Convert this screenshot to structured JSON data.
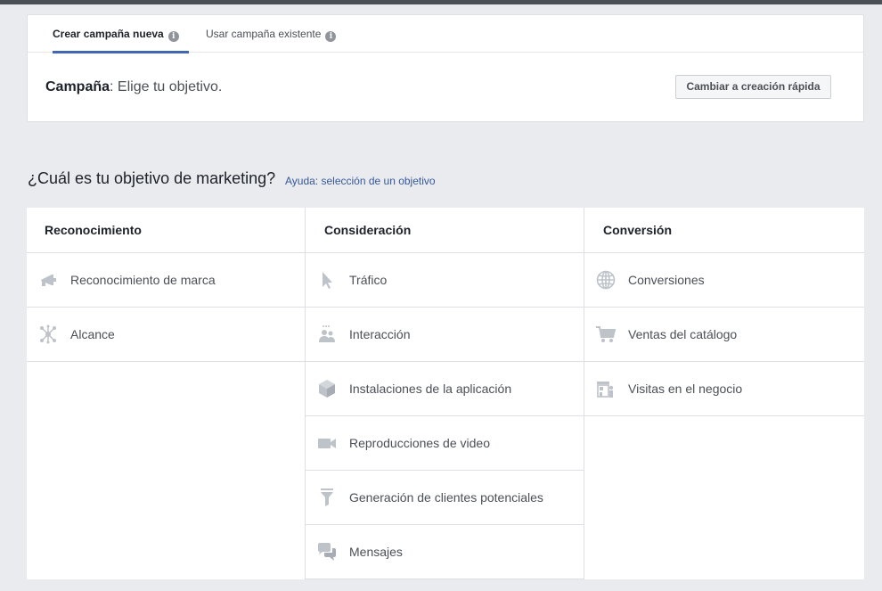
{
  "tabs": [
    {
      "label": "Crear campaña nueva",
      "icon": "info-icon"
    },
    {
      "label": "Usar campaña existente",
      "icon": "info-icon"
    }
  ],
  "campaign": {
    "label": "Campaña",
    "text": ": Elige tu objetivo."
  },
  "quick_button": "Cambiar a creación rápida",
  "question": "¿Cuál es tu objetivo de marketing?",
  "help_link": "Ayuda: selección de un objetivo",
  "columns": [
    {
      "title": "Reconocimiento",
      "items": [
        {
          "label": "Reconocimiento de marca",
          "icon": "megaphone-icon"
        },
        {
          "label": "Alcance",
          "icon": "reach-icon"
        }
      ]
    },
    {
      "title": "Consideración",
      "items": [
        {
          "label": "Tráfico",
          "icon": "cursor-icon"
        },
        {
          "label": "Interacción",
          "icon": "people-icon"
        },
        {
          "label": "Instalaciones de la aplicación",
          "icon": "box-icon"
        },
        {
          "label": "Reproducciones de video",
          "icon": "video-camera-icon"
        },
        {
          "label": "Generación de clientes potenciales",
          "icon": "funnel-icon"
        },
        {
          "label": "Mensajes",
          "icon": "chat-bubbles-icon"
        }
      ]
    },
    {
      "title": "Conversión",
      "items": [
        {
          "label": "Conversiones",
          "icon": "globe-icon"
        },
        {
          "label": "Ventas del catálogo",
          "icon": "cart-icon"
        },
        {
          "label": "Visitas en el negocio",
          "icon": "store-icon"
        }
      ]
    }
  ],
  "colors": {
    "accent": "#4267b2",
    "link": "#365899",
    "icon": "#bec3c9"
  }
}
